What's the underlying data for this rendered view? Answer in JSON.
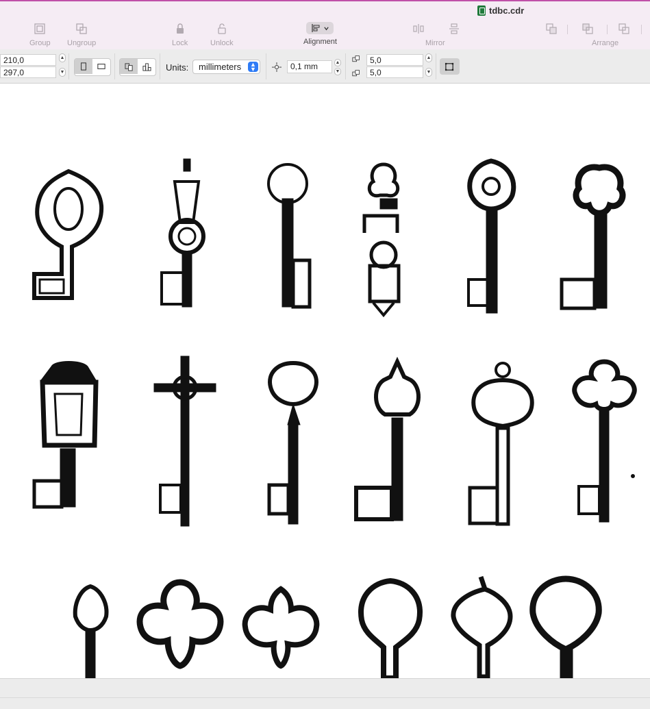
{
  "window": {
    "file_name": "tdbc.cdr"
  },
  "toolbar": {
    "group_label": "Group",
    "ungroup_label": "Ungroup",
    "lock_label": "Lock",
    "unlock_label": "Unlock",
    "alignment_label": "Alignment",
    "mirror_label": "Mirror",
    "arrange_label": "Arrange"
  },
  "propbar": {
    "page_width": "210,0",
    "page_height": "297,0",
    "units_label": "Units:",
    "units_value": "millimeters",
    "nudge_value": "0,1 mm",
    "duplicate_x": "5,0",
    "duplicate_y": "5,0"
  },
  "canvas": {
    "content": "key-illustrations",
    "rows": [
      {
        "keys": [
          "ornate-shield-key",
          "lantern-key",
          "round-bow-key",
          "trefoil-double-key",
          "scrollwork-key",
          "cloverleaf-key"
        ]
      },
      {
        "keys": [
          "casket-key",
          "cross-bow-key",
          "fan-bow-key",
          "crown-key",
          "ring-bow-key",
          "flower-bow-key"
        ]
      },
      {
        "keys": [
          "small-bow-key",
          "quatrefoil-key",
          "lattice-key",
          "loop-heart-key",
          "royal-crest-key",
          "heart-crest-key"
        ]
      }
    ]
  },
  "colors": {
    "accent": "#c050a8",
    "ink": "#111111",
    "select_blue": "#2f7cf6"
  }
}
